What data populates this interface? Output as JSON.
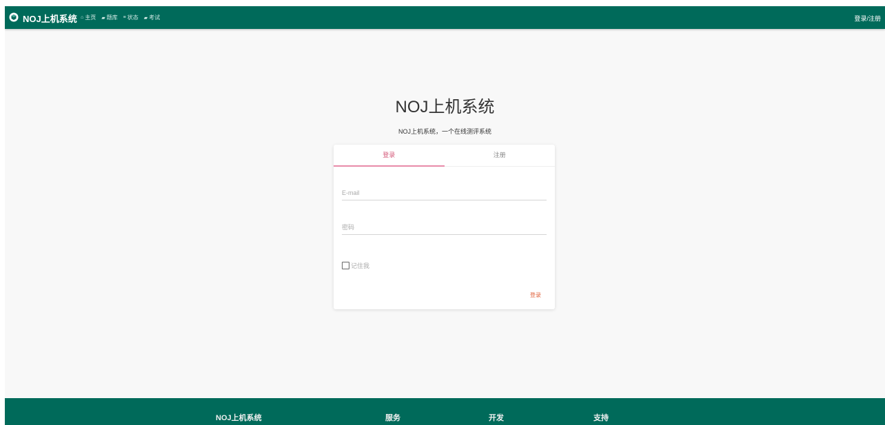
{
  "navbar": {
    "brand": "NOJ上机系统",
    "links": [
      {
        "icon": "home-icon",
        "glyph": "⌂",
        "label": "主页"
      },
      {
        "icon": "book-icon",
        "glyph": "▰",
        "label": "题库"
      },
      {
        "icon": "list-icon",
        "glyph": "≡",
        "label": "状态"
      },
      {
        "icon": "book-icon",
        "glyph": "▰",
        "label": "考试"
      }
    ],
    "login_register": "登录/注册"
  },
  "hero": {
    "title": "NOJ上机系统",
    "subtitle": "NOJ上机系统，一个在线测评系统"
  },
  "auth_card": {
    "tabs": [
      {
        "label": "登录",
        "active": true
      },
      {
        "label": "注册",
        "active": false
      }
    ],
    "email_placeholder": "E-mail",
    "email_value": "",
    "password_placeholder": "密码",
    "password_value": "",
    "remember_label": "记住我",
    "remember_checked": false,
    "submit_label": "登录"
  },
  "footer": {
    "columns": [
      "NOJ上机系统",
      "服务",
      "开发",
      "支持"
    ]
  },
  "colors": {
    "primary": "#006a5a",
    "accent_pink": "#e88aa8",
    "submit": "#e0603a",
    "background": "#f8f8f8"
  }
}
